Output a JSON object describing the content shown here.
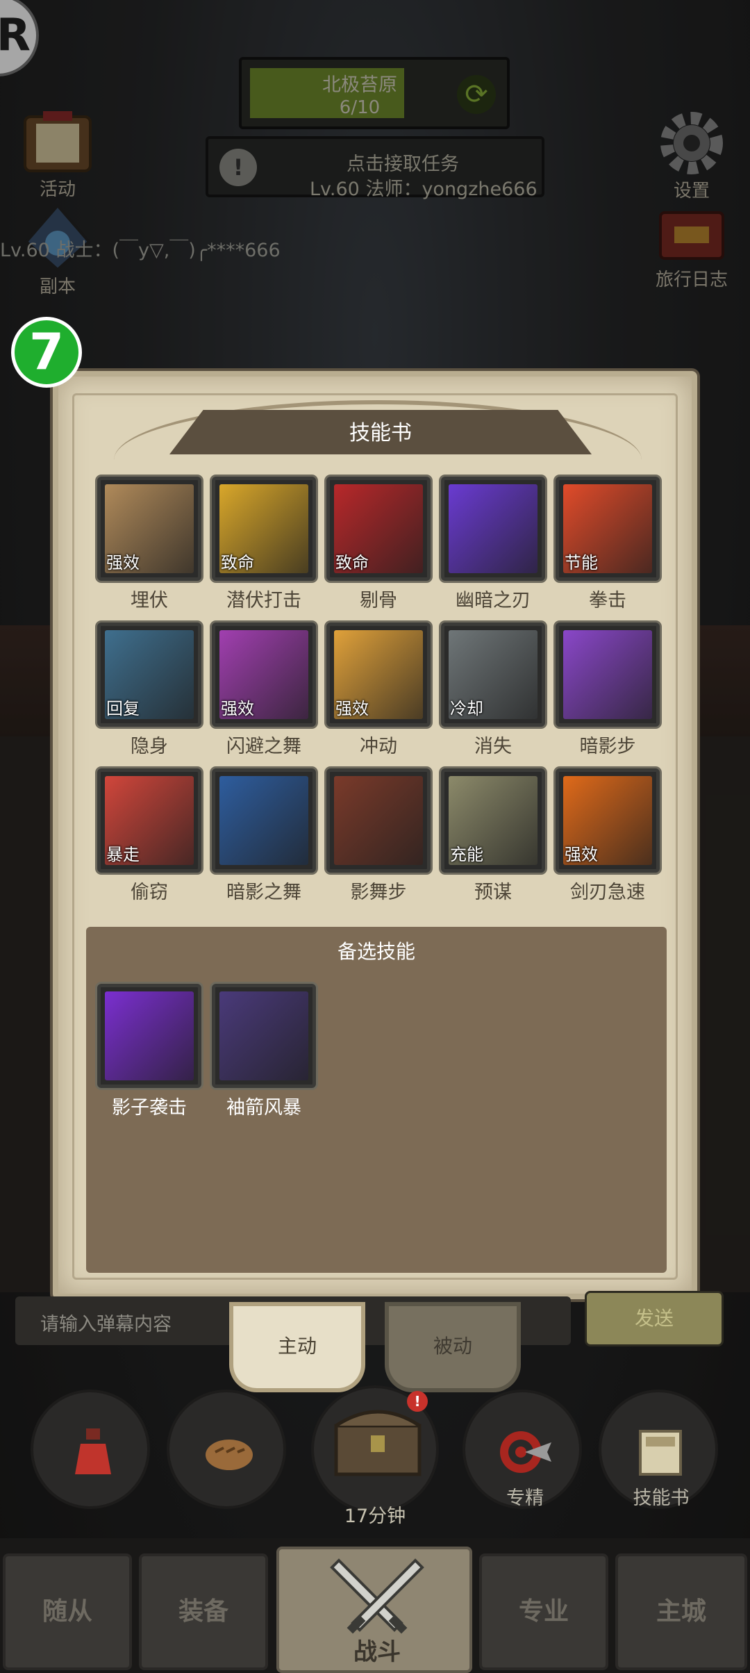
{
  "hud": {
    "zone_name": "北极苔原",
    "zone_progress": "6/10",
    "zone_progress_fraction": 0.6,
    "task_title": "点击接取任务",
    "task_subtitle": "Lv.60 法师：yongzhe666",
    "chat_message": "Lv.60 战士：(￣y▽,￣)╭****666",
    "left_buttons": [
      "活动",
      "副本"
    ],
    "right_buttons": [
      "设置",
      "旅行日志"
    ],
    "corner_badge": "R",
    "floating_badge": "7"
  },
  "skill_book": {
    "title": "技能书",
    "equipped": [
      {
        "name": "埋伏",
        "tag": "强效",
        "icon": "ambush-icon",
        "color": "#b08a5a"
      },
      {
        "name": "潜伏打击",
        "tag": "致命",
        "icon": "lurking-strike-icon",
        "color": "#d9a72a"
      },
      {
        "name": "剔骨",
        "tag": "致命",
        "icon": "bone-carve-icon",
        "color": "#b8282a"
      },
      {
        "name": "幽暗之刃",
        "tag": "",
        "icon": "dark-blade-icon",
        "color": "#6a3bd1"
      },
      {
        "name": "拳击",
        "tag": "节能",
        "icon": "punch-icon",
        "color": "#e14b2a"
      },
      {
        "name": "隐身",
        "tag": "回复",
        "icon": "stealth-icon",
        "color": "#3f6f8e"
      },
      {
        "name": "闪避之舞",
        "tag": "强效",
        "icon": "evasion-dance-icon",
        "color": "#a13fb0"
      },
      {
        "name": "冲动",
        "tag": "强效",
        "icon": "impulse-icon",
        "color": "#e0a13a"
      },
      {
        "name": "消失",
        "tag": "冷却",
        "icon": "vanish-icon",
        "color": "#6f7678"
      },
      {
        "name": "暗影步",
        "tag": "",
        "icon": "shadow-step-icon",
        "color": "#8a47c9"
      },
      {
        "name": "偷窃",
        "tag": "暴走",
        "icon": "steal-icon",
        "color": "#d1463b"
      },
      {
        "name": "暗影之舞",
        "tag": "",
        "icon": "shadow-dance-icon",
        "color": "#2e5d9e"
      },
      {
        "name": "影舞步",
        "tag": "",
        "icon": "shadow-waltz-icon",
        "color": "#7a3a2a"
      },
      {
        "name": "预谋",
        "tag": "充能",
        "icon": "premeditation-icon",
        "color": "#8c8a6a"
      },
      {
        "name": "剑刃急速",
        "tag": "强效",
        "icon": "blade-flurry-icon",
        "color": "#e06a1a"
      }
    ],
    "alternates_title": "备选技能",
    "alternates": [
      {
        "name": "影子袭击",
        "icon": "shadow-strike-icon",
        "color": "#7b2fd0"
      },
      {
        "name": "袖箭风暴",
        "icon": "sleeve-arrow-storm-icon",
        "color": "#4a3a7a"
      }
    ]
  },
  "tabs": [
    "主动",
    "被动"
  ],
  "danmu": {
    "placeholder": "请输入弹幕内容",
    "send_label": "发送"
  },
  "quick_slots": {
    "labels": [
      "",
      "",
      "",
      "专精",
      "技能书"
    ],
    "chest_timer": "17分钟",
    "chest_alert": "!"
  },
  "nav": {
    "items": [
      "随从",
      "装备",
      "战斗",
      "专业",
      "主城"
    ]
  }
}
